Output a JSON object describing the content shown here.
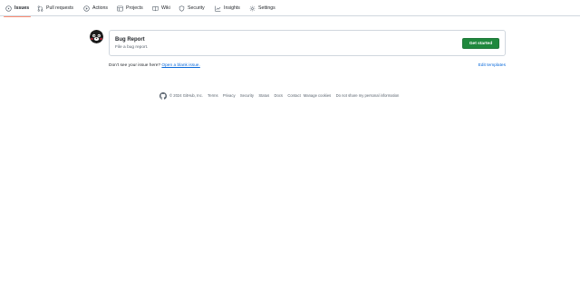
{
  "nav": {
    "tabs": [
      {
        "label": "Issues",
        "icon": "issue-opened-icon",
        "selected": true
      },
      {
        "label": "Pull requests",
        "icon": "git-pull-request-icon"
      },
      {
        "label": "Actions",
        "icon": "play-icon"
      },
      {
        "label": "Projects",
        "icon": "table-icon"
      },
      {
        "label": "Wiki",
        "icon": "book-icon"
      },
      {
        "label": "Security",
        "icon": "shield-icon"
      },
      {
        "label": "Insights",
        "icon": "graph-icon"
      },
      {
        "label": "Settings",
        "icon": "gear-icon"
      }
    ]
  },
  "templates": [
    {
      "title": "Bug Report",
      "description": "File a bug report.",
      "action_label": "Get started"
    }
  ],
  "blank_issue": {
    "prompt": "Don’t see your issue here?",
    "link_label": "Open a blank issue.",
    "edit_label": "Edit templates"
  },
  "footer": {
    "copyright": "© 2024 GitHub, Inc.",
    "links": [
      "Terms",
      "Privacy",
      "Security",
      "Status",
      "Docs",
      "Contact",
      "Manage cookies",
      "Do not share my personal information"
    ]
  },
  "colors": {
    "accent": "#0969da",
    "primary_button": "#1f883d",
    "selected_tab_underline": "#fd8c73",
    "border": "#d0d7de",
    "muted_text": "#59636e"
  }
}
